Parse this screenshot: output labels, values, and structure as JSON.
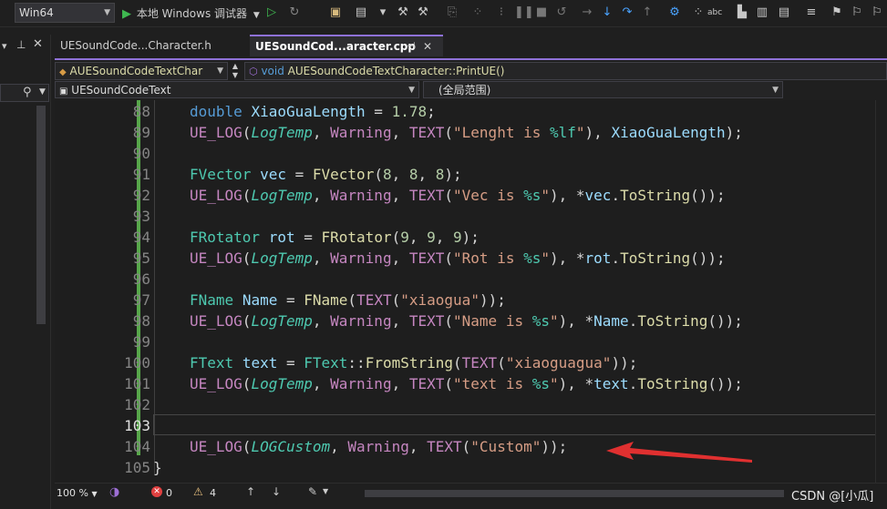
{
  "toolbar": {
    "platform": "Win64",
    "run_label": "本地 Windows 调试器"
  },
  "tabs": [
    {
      "label": "UESoundCode...Character.h",
      "active": false
    },
    {
      "label": "UESoundCod...aracter.cpp",
      "active": true
    }
  ],
  "nav": {
    "class_combo": "AUESoundCodeTextChar",
    "member_combo_kw": "void",
    "member_combo_text": "AUESoundCodeTextCharacter::PrintUE()",
    "project_combo": "UESoundCodeText",
    "scope_combo": "(全局范围)"
  },
  "editor": {
    "lines": [
      {
        "num": "88",
        "text": "double XiaoGuaLength = 1.78;"
      },
      {
        "num": "89",
        "text": "UE_LOG(LogTemp, Warning, TEXT(\"Lenght is %lf\"), XiaoGuaLength);"
      },
      {
        "num": "90",
        "text": ""
      },
      {
        "num": "91",
        "text": "FVector vec = FVector(8, 8, 8);"
      },
      {
        "num": "92",
        "text": "UE_LOG(LogTemp, Warning, TEXT(\"Vec is %s\"), *vec.ToString());"
      },
      {
        "num": "93",
        "text": ""
      },
      {
        "num": "94",
        "text": "FRotator rot = FRotator(9, 9, 9);"
      },
      {
        "num": "95",
        "text": "UE_LOG(LogTemp, Warning, TEXT(\"Rot is %s\"), *rot.ToString());"
      },
      {
        "num": "96",
        "text": ""
      },
      {
        "num": "97",
        "text": "FName Name = FName(TEXT(\"xiaogua\"));"
      },
      {
        "num": "98",
        "text": "UE_LOG(LogTemp, Warning, TEXT(\"Name is %s\"), *Name.ToString());"
      },
      {
        "num": "99",
        "text": ""
      },
      {
        "num": "100",
        "text": "FText text = FText::FromString(TEXT(\"xiaoguagua\"));"
      },
      {
        "num": "101",
        "text": "UE_LOG(LogTemp, Warning, TEXT(\"text is %s\"), *text.ToString());"
      },
      {
        "num": "102",
        "text": ""
      },
      {
        "num": "103",
        "text": ""
      },
      {
        "num": "104",
        "text": "UE_LOG(LOGCustom, Warning, TEXT(\"Custom\"));"
      },
      {
        "num": "105",
        "text": "}"
      }
    ]
  },
  "status": {
    "zoom": "100 %",
    "errors": "0",
    "warnings": "4",
    "watermark": "CSDN @[小瓜]"
  },
  "colors": {
    "keyword": "#569cd6",
    "type": "#4ec9b0",
    "function": "#dcdcaa",
    "macro": "#c586c0",
    "string": "#d69d85",
    "change_bar": "#57a64a",
    "annotation_arrow": "#e03030"
  }
}
